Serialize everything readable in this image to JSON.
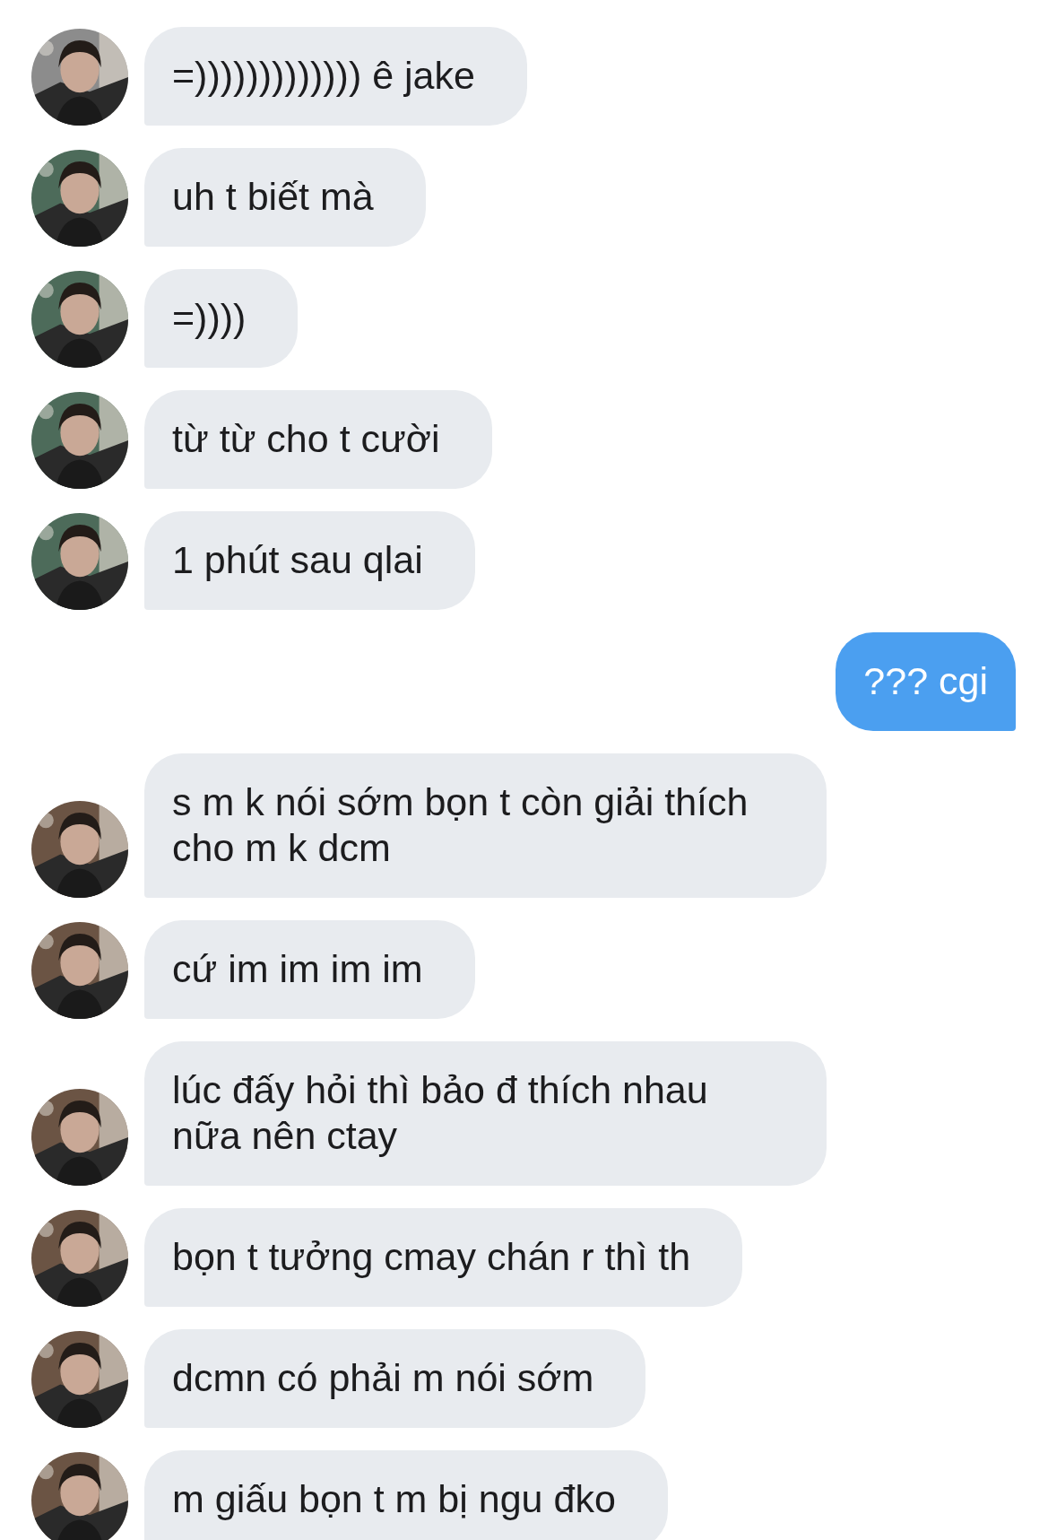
{
  "messages": [
    {
      "kind": "received",
      "text": "=))))))))))))) ê jake"
    },
    {
      "kind": "received",
      "text": "uh t biết mà"
    },
    {
      "kind": "received",
      "text": "=))))"
    },
    {
      "kind": "received",
      "text": "từ từ cho t cười"
    },
    {
      "kind": "received",
      "text": "1 phút sau qlai"
    },
    {
      "kind": "sent",
      "text": "??? cgi"
    },
    {
      "kind": "received",
      "text": "s m k nói sớm bọn t còn giải thích cho m k dcm"
    },
    {
      "kind": "received",
      "text": "cứ im im im im"
    },
    {
      "kind": "received",
      "text": "lúc đấy hỏi thì bảo đ thích nhau nữa nên ctay"
    },
    {
      "kind": "received",
      "text": "bọn t tưởng cmay chán r thì th"
    },
    {
      "kind": "received",
      "text": "dcmn có phải m nói sớm"
    },
    {
      "kind": "received",
      "text": "m giấu bọn t m bị ngu đko"
    }
  ]
}
